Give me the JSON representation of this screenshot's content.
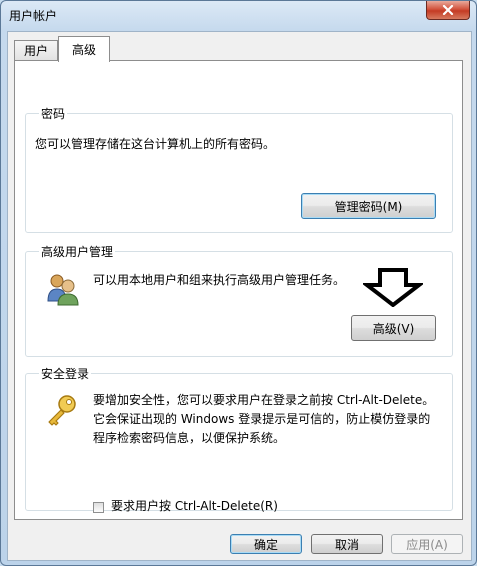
{
  "window": {
    "title": "用户帐户"
  },
  "tabs": [
    {
      "label": "用户"
    },
    {
      "label": "高级"
    }
  ],
  "password_group": {
    "title": "密码",
    "description": "您可以管理存储在这台计算机上的所有密码。",
    "button_label": "管理密码(M)"
  },
  "advanced_group": {
    "title": "高级用户管理",
    "description": "可以用本地用户和组来执行高级用户管理任务。",
    "button_label": "高级(V)"
  },
  "secure_group": {
    "title": "安全登录",
    "description_lines": [
      "要增加安全性，您可以要求用户在登录之前按 Ctrl-Alt-Delete。",
      "它会保证出现的 Windows 登录提示是可信的，防止模仿登录的",
      "程序检索密码信息，以便保护系统。"
    ],
    "checkbox_label": "要求用户按 Ctrl-Alt-Delete(R)",
    "checkbox_checked": false
  },
  "footer": {
    "ok_label": "确定",
    "cancel_label": "取消",
    "apply_label": "应用(A)"
  },
  "colors": {
    "close_button": "#c43b24",
    "focus_border": "#3c7fb1",
    "annotation_arrow": "#000000"
  }
}
